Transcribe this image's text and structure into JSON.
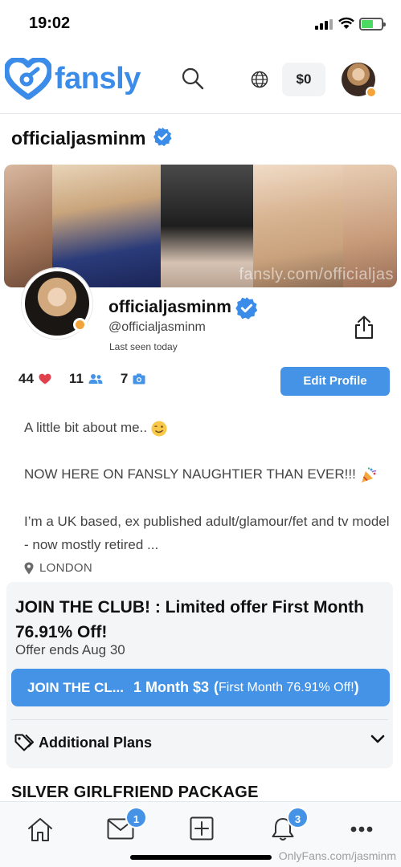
{
  "status_bar": {
    "time": "19:02"
  },
  "nav": {
    "logo_text": "fansly",
    "balance": "$0"
  },
  "header": {
    "username": "officialjasminm"
  },
  "banner": {
    "watermark": "fansly.com/officialjas"
  },
  "profile": {
    "display_name": "officialjasminm",
    "handle": "@officialjasminm",
    "last_seen": "Last seen today",
    "edit_button": "Edit Profile"
  },
  "stats": {
    "likes": "44",
    "followers": "11",
    "media": "7"
  },
  "bio": {
    "line1": "A little bit about me.. ",
    "line2": "NOW HERE ON FANSLY NAUGHTIER THAN EVER!!! ",
    "line3": "I’m a UK based, ex published adult/glamour/fet and tv model - now mostly retired ...",
    "location": "LONDON"
  },
  "offer": {
    "title": "JOIN THE CLUB! : Limited offer First Month 76.91% Off!",
    "ends": "Offer ends Aug 30",
    "button_name": "JOIN THE CL...",
    "button_price": "1 Month $3",
    "button_paren_open": "(",
    "button_note": "First Month 76.91% Off!",
    "button_paren_close": ")",
    "additional_plans": "Additional Plans"
  },
  "package": {
    "title": "SILVER GIRLFRIEND PACKAGE"
  },
  "bottom_nav": {
    "messages_badge": "1",
    "notifications_badge": "3"
  },
  "footer_watermark": "OnlyFans.com/jasminm",
  "colors": {
    "brand_blue": "#3b8ce8",
    "button_blue": "#4593e6",
    "online_orange": "#f2a33a",
    "heart_red": "#e0424d"
  }
}
